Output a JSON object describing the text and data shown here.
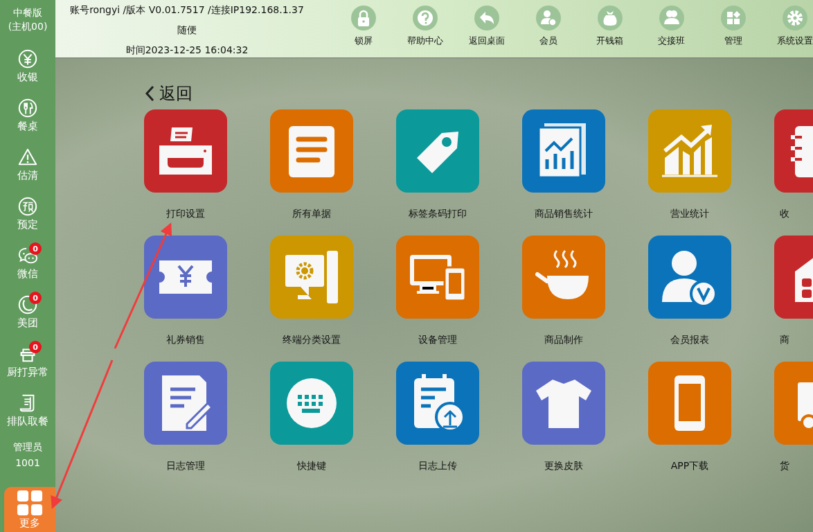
{
  "sidebar": {
    "title": "中餐版",
    "subtitle": "(主机00)",
    "items": [
      {
        "label": "收银",
        "selected": false
      },
      {
        "label": "餐桌",
        "selected": false
      },
      {
        "label": "估清",
        "selected": false
      },
      {
        "label": "预定",
        "selected": false
      },
      {
        "label": "微信",
        "badge": "0",
        "selected": false
      },
      {
        "label": "美团",
        "badge": "0",
        "selected": false
      },
      {
        "label": "厨打异常",
        "badge": "0",
        "selected": false
      },
      {
        "label": "排队取餐",
        "selected": false
      }
    ],
    "user_role": "管理员",
    "user_id": "1001",
    "more": {
      "label": "更多",
      "selected": true
    }
  },
  "header": {
    "account_line": "账号rongyi /版本 V0.01.7517 /连接IP192.168.1.37",
    "store": "随便",
    "time": "时间2023-12-25 16:04:32"
  },
  "toolbar": [
    {
      "label": "锁屏"
    },
    {
      "label": "帮助中心"
    },
    {
      "label": "返回桌面"
    },
    {
      "label": "会员"
    },
    {
      "label": "开钱箱"
    },
    {
      "label": "交接班"
    },
    {
      "label": "管理"
    },
    {
      "label": "系统设置"
    }
  ],
  "back": "返回",
  "tiles": [
    {
      "label": "打印设置",
      "color": "#c4282a"
    },
    {
      "label": "所有单据",
      "color": "#dc6d00"
    },
    {
      "label": "标签条码打印",
      "color": "#0b999a"
    },
    {
      "label": "商品销售统计",
      "color": "#0b73b9"
    },
    {
      "label": "营业统计",
      "color": "#cc9700"
    },
    {
      "label": "收",
      "color": "#c4282a"
    },
    {
      "label": "礼券销售",
      "color": "#5b6ac4"
    },
    {
      "label": "终端分类设置",
      "color": "#cc9700"
    },
    {
      "label": "设备管理",
      "color": "#dc6d00"
    },
    {
      "label": "商品制作",
      "color": "#dc6d00"
    },
    {
      "label": "会员报表",
      "color": "#0b73b9"
    },
    {
      "label": "商",
      "color": "#c4282a"
    },
    {
      "label": "日志管理",
      "color": "#5b6ac4"
    },
    {
      "label": "快捷键",
      "color": "#0b999a"
    },
    {
      "label": "日志上传",
      "color": "#0b73b9"
    },
    {
      "label": "更换皮肤",
      "color": "#5b6ac4"
    },
    {
      "label": "APP下载",
      "color": "#dc6d00"
    },
    {
      "label": "货",
      "color": "#dc6d00"
    }
  ]
}
